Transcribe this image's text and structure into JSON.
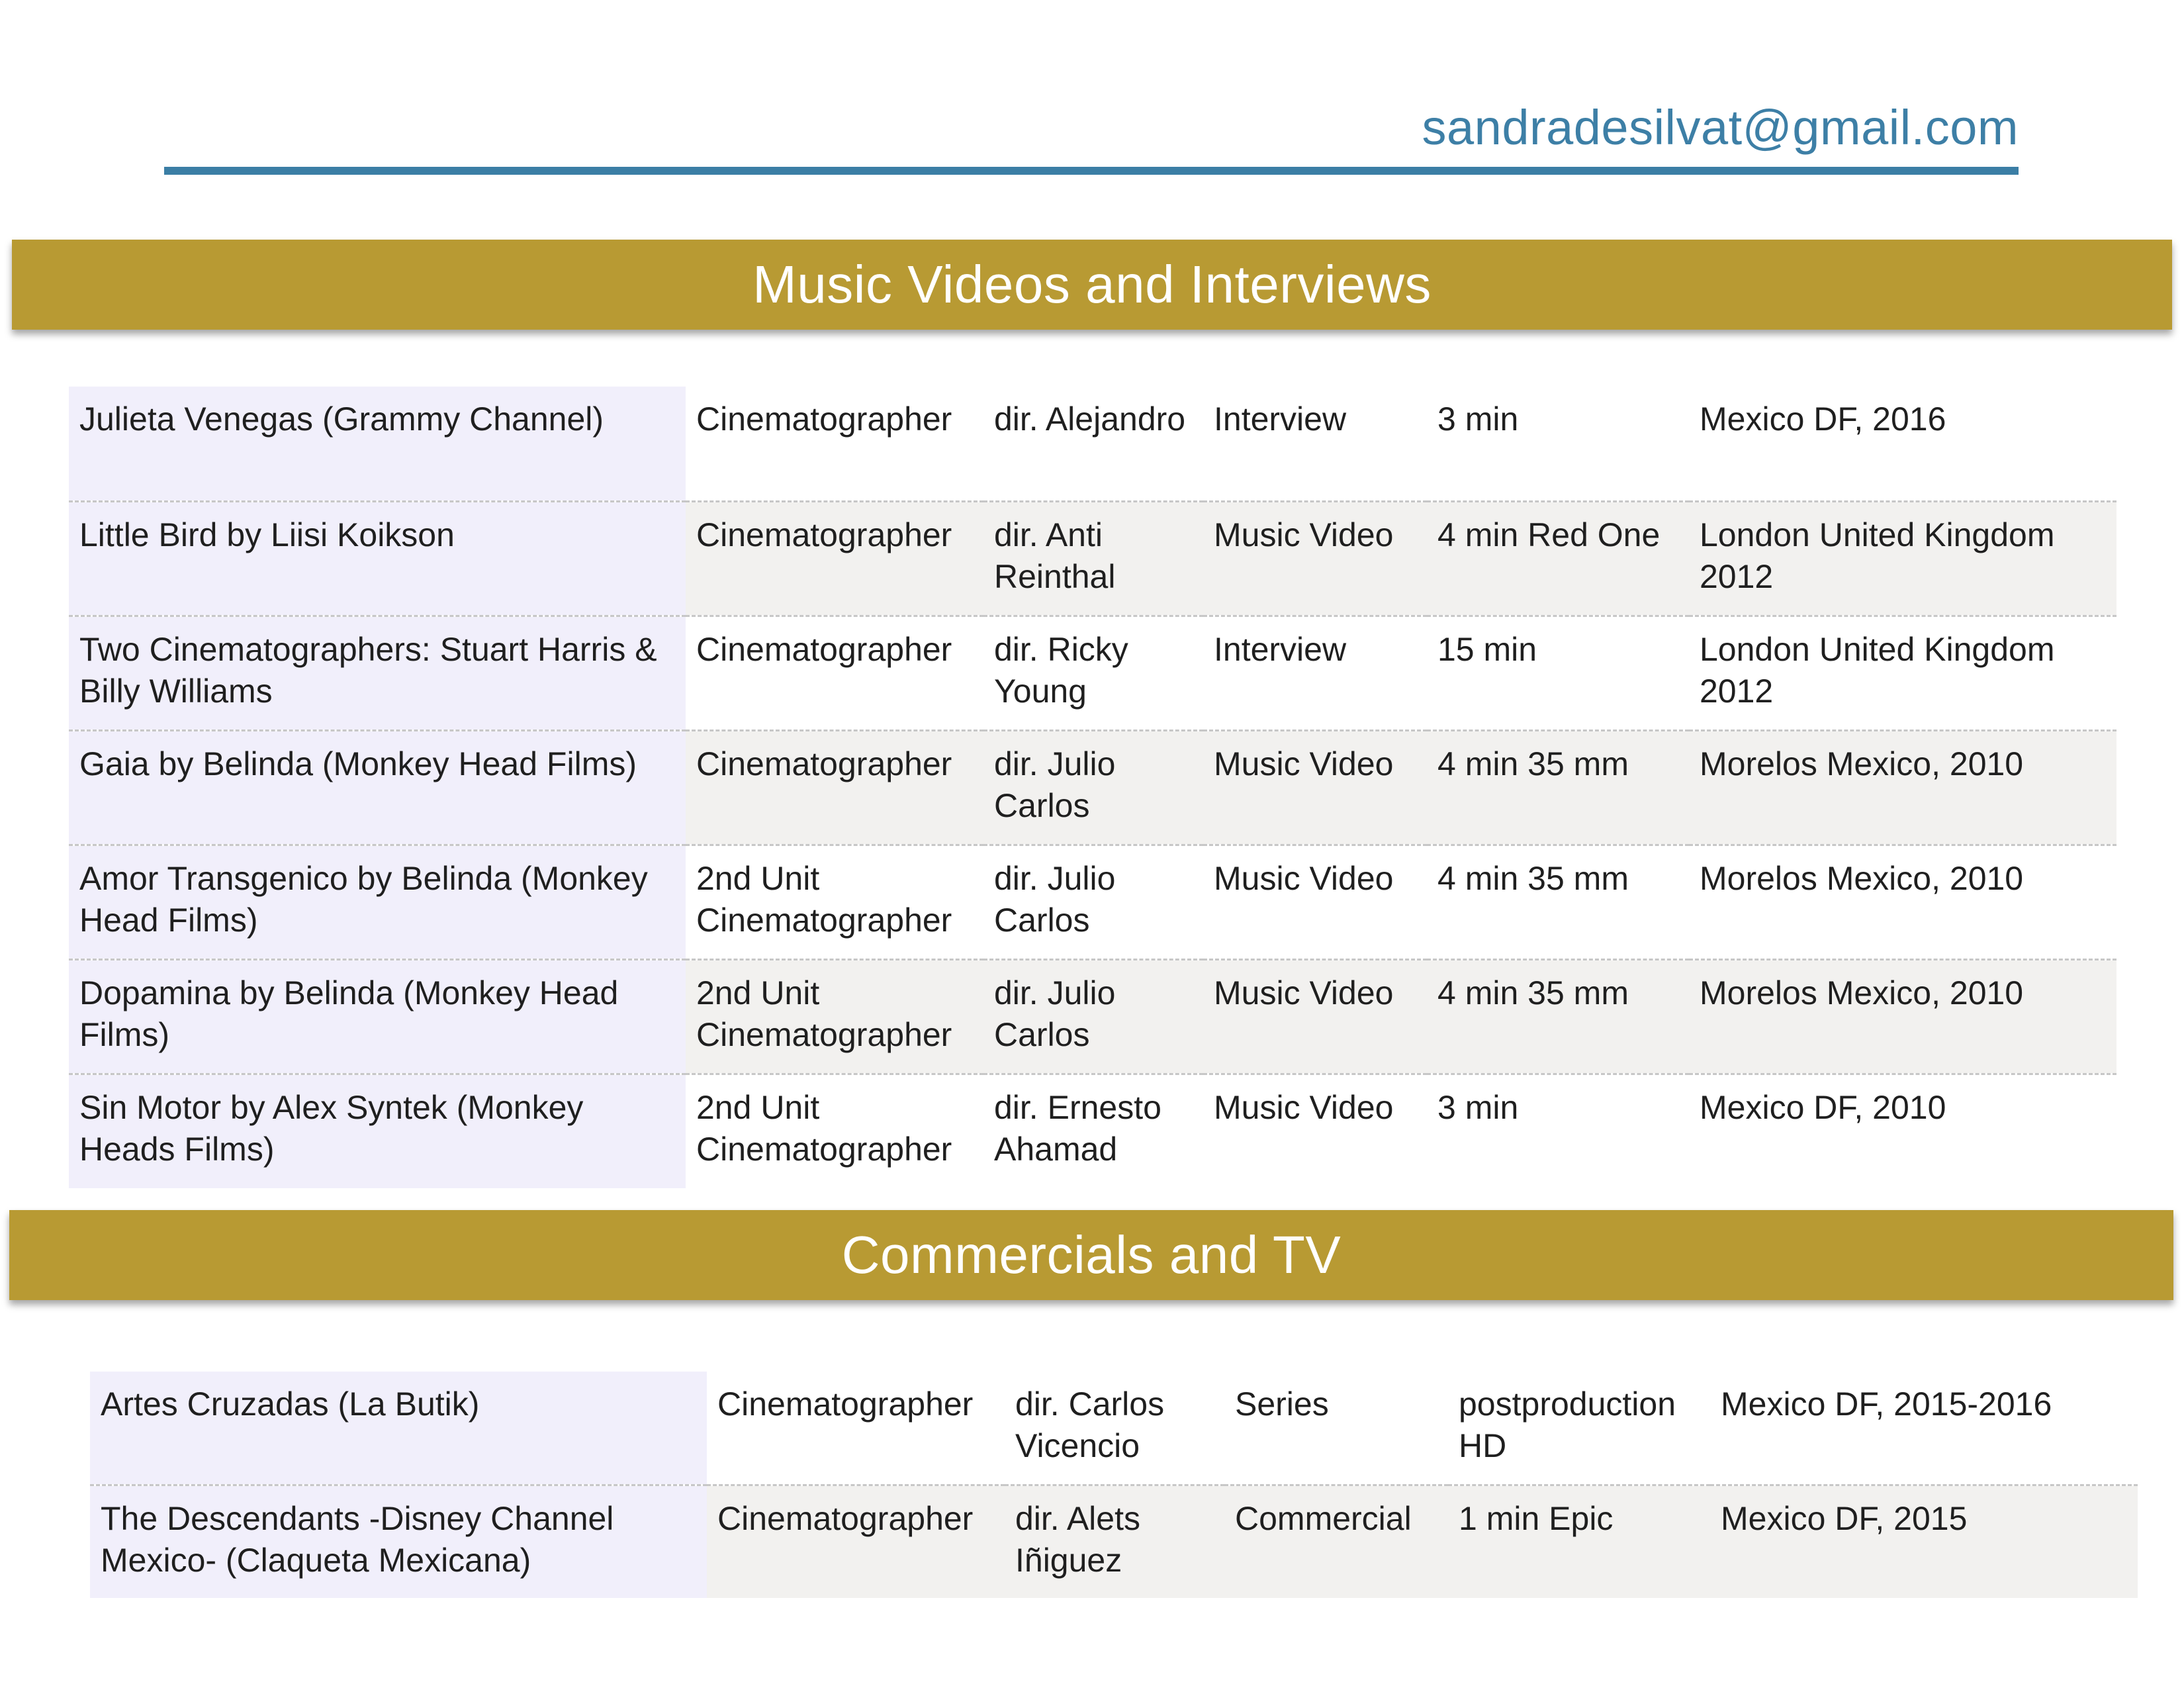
{
  "header": {
    "email": "sandradesilvat@gmail.com"
  },
  "sections": [
    {
      "title": "Music Videos and Interviews",
      "rows": [
        [
          "Julieta Venegas (Grammy Channel)",
          "Cinematographer",
          "dir. Alejandro",
          "Interview",
          "3 min",
          "Mexico DF, 2016"
        ],
        [
          "Little Bird by Liisi Koikson",
          "Cinematographer",
          "dir. Anti Reinthal",
          "Music Video",
          "4 min Red One",
          "London United Kingdom 2012"
        ],
        [
          "Two Cinematographers: Stuart Harris & Billy Williams",
          "Cinematographer",
          "dir. Ricky Young",
          "Interview",
          "15 min",
          "London United Kingdom 2012"
        ],
        [
          "Gaia by Belinda (Monkey Head Films)",
          "Cinematographer",
          "dir. Julio Carlos",
          "Music Video",
          "4 min 35 mm",
          "Morelos Mexico, 2010"
        ],
        [
          "Amor Transgenico by Belinda (Monkey Head Films)",
          "2nd Unit Cinematographer",
          "dir. Julio Carlos",
          "Music Video",
          "4 min 35 mm",
          "Morelos Mexico, 2010"
        ],
        [
          "Dopamina by Belinda (Monkey Head Films)",
          "2nd Unit Cinematographer",
          "dir. Julio Carlos",
          "Music Video",
          "4 min 35 mm",
          "Morelos Mexico, 2010"
        ],
        [
          "Sin Motor by Alex Syntek (Monkey Heads Films)",
          "2nd Unit Cinematographer",
          "dir. Ernesto Ahamad",
          "Music Video",
          "3 min",
          "Mexico DF, 2010"
        ]
      ]
    },
    {
      "title": "Commercials and TV",
      "rows": [
        [
          "Artes Cruzadas (La Butik)",
          "Cinematographer",
          "dir. Carlos Vicencio",
          "Series",
          "postproduction HD",
          "Mexico DF, 2015-2016"
        ],
        [
          "The Descendants -Disney Channel Mexico- (Claqueta Mexicana)",
          "Cinematographer",
          "dir. Alets Iñiguez",
          "Commercial",
          "1 min Epic",
          "Mexico DF, 2015"
        ]
      ]
    }
  ]
}
